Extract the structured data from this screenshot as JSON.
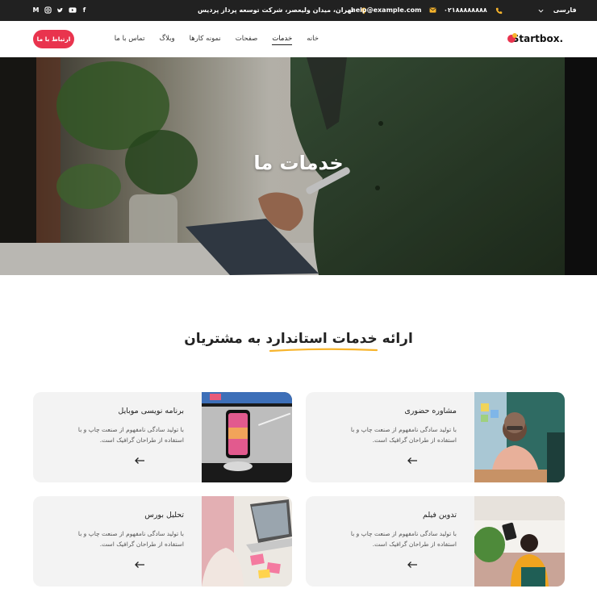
{
  "topbar": {
    "language": "فارسی",
    "phone": "۰۲۱۸۸۸۸۸۸۸۸",
    "email": "help@example.com",
    "address": "تهران، میدان ولیعصر، شرکت توسعه پرداز پردیس",
    "socials": [
      "facebook-icon",
      "twitter-icon",
      "youtube-icon",
      "instagram-icon",
      "medium-icon"
    ],
    "accent": "#f7b42c"
  },
  "nav": {
    "brand": "Startbox.",
    "items": [
      "خانه",
      "خدمات",
      "صفحات",
      "نمونه کارها",
      "وبلاگ",
      "تماس با ما"
    ],
    "active_index": 1,
    "cta": "ارتباط با ما",
    "cta_color": "#e9344e"
  },
  "hero": {
    "title": "خدمات ما"
  },
  "section": {
    "title": "ارائه خدمات استاندارد به مشتریان",
    "highlight_color": "#f7b42c"
  },
  "services": [
    {
      "title": "مشاوره حضوری",
      "desc": "با تولید سادگی نامفهوم از صنعت چاپ و با استفاده از طراحان گرافیک است.",
      "image": "woman-laughing-photo"
    },
    {
      "title": "برنامه نویسی موبایل",
      "desc": "با تولید سادگی نامفهوم از صنعت چاپ و با استفاده از طراحان گرافیک است.",
      "image": "phone-on-stand-photo"
    },
    {
      "title": "تدوین فیلم",
      "desc": "با تولید سادگی نامفهوم از صنعت چاپ و با استفاده از طراحان گرافیک است.",
      "image": "woman-working-desk-photo"
    },
    {
      "title": "تحلیل بورس",
      "desc": "با تولید سادگی نامفهوم از صنعت چاپ و با استفاده از طراحان گرافیک است.",
      "image": "laptop-sticky-notes-photo"
    }
  ]
}
